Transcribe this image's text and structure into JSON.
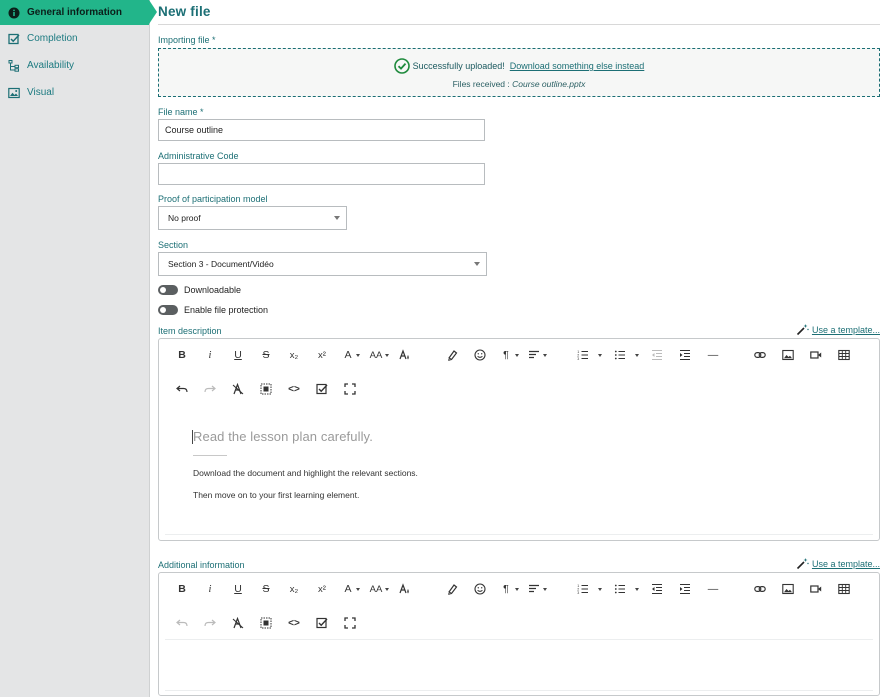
{
  "sidebar": {
    "items": [
      {
        "label": "General information",
        "icon": "info-icon",
        "active": true
      },
      {
        "label": "Completion",
        "icon": "checkbox-icon"
      },
      {
        "label": "Availability",
        "icon": "sitemap-icon"
      },
      {
        "label": "Visual",
        "icon": "image-icon"
      }
    ]
  },
  "page": {
    "title": "New file"
  },
  "import": {
    "label": "Importing file *",
    "success_text": "Successfully uploaded!",
    "download_link": "Download something else instead",
    "files_received_label": "Files received :",
    "file_name": "Course outline.pptx"
  },
  "file_name": {
    "label": "File name *",
    "value": "Course outline"
  },
  "admin_code": {
    "label": "Administrative Code",
    "value": ""
  },
  "proof_model": {
    "label": "Proof of participation model",
    "selected": "No proof"
  },
  "section": {
    "label": "Section",
    "selected": "Section 3 - Document/Vidéo"
  },
  "toggles": {
    "downloadable": {
      "label": "Downloadable",
      "on": false
    },
    "file_protection": {
      "label": "Enable file protection",
      "on": false
    }
  },
  "item_description": {
    "label": "Item description",
    "template_link": "Use a template...",
    "heading": "Read the lesson plan carefully.",
    "paragraphs": [
      "Download the document and highlight the relevant sections.",
      "Then move on to your first learning element."
    ]
  },
  "additional_info": {
    "label": "Additional information",
    "template_link": "Use a template..."
  },
  "toolbar": {
    "bold": "B",
    "italic": "i",
    "underline": "U",
    "strike": "S",
    "subscript": "x₂",
    "superscript": "x²",
    "font_color": "A",
    "font_size": "AA",
    "ordered_list": "1≡",
    "bullet_list": "•≡",
    "paragraph": "¶",
    "hr": "—",
    "code_view": "<>"
  },
  "colors": {
    "accent": "#22b58a",
    "teal": "#1c6f75",
    "sidebar_bg": "#e4e5e6"
  }
}
